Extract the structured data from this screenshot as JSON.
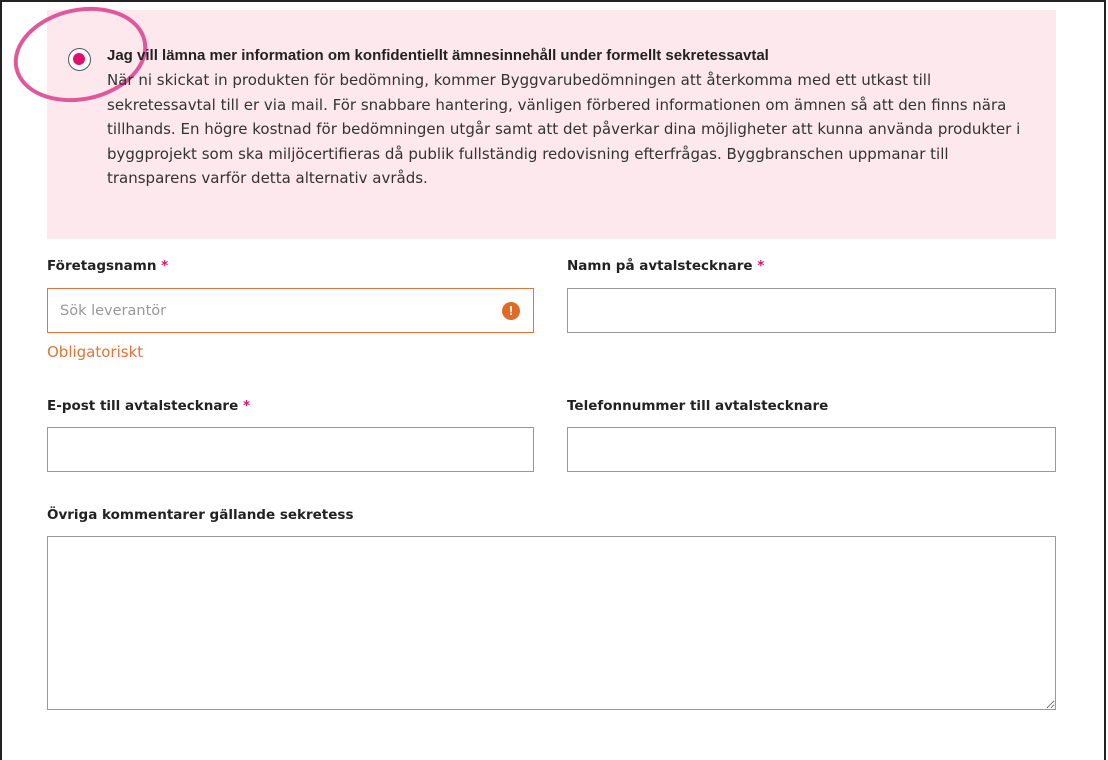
{
  "notice": {
    "title": "Jag vill lämna mer information om konfidentiellt ämnesinnehåll under formellt sekretessavtal",
    "body": "När ni skickat in produkten för bedömning, kommer Byggvarubedömningen att återkomma med ett utkast till sekretessavtal till er via mail. För snabbare hantering, vänligen förbered informationen om ämnen så att den finns nära tillhands. En högre kostnad för bedömningen utgår samt att det påverkar dina möjligheter att kunna använda produkter i byggprojekt som ska miljöcertifieras då publik fullständig redovisning efterfrågas. Byggbranschen uppmanar till transparens varför detta alternativ avråds.",
    "selected": true,
    "accent_color": "#e0106e",
    "background_color": "#fde8ee"
  },
  "form": {
    "company": {
      "label": "Företagsnamn",
      "required_mark": "*",
      "placeholder": "Sök leverantör",
      "value": "",
      "error": "Obligatoriskt",
      "error_icon": "exclamation-circle-icon"
    },
    "signer_name": {
      "label": "Namn på avtalstecknare",
      "required_mark": "*",
      "value": ""
    },
    "signer_email": {
      "label": "E-post till avtalstecknare",
      "required_mark": "*",
      "value": ""
    },
    "signer_phone": {
      "label": "Telefonnummer till avtalstecknare",
      "value": ""
    },
    "comments": {
      "label": "Övriga kommentarer gällande sekretess",
      "value": ""
    },
    "error_color": "#e0743a"
  }
}
